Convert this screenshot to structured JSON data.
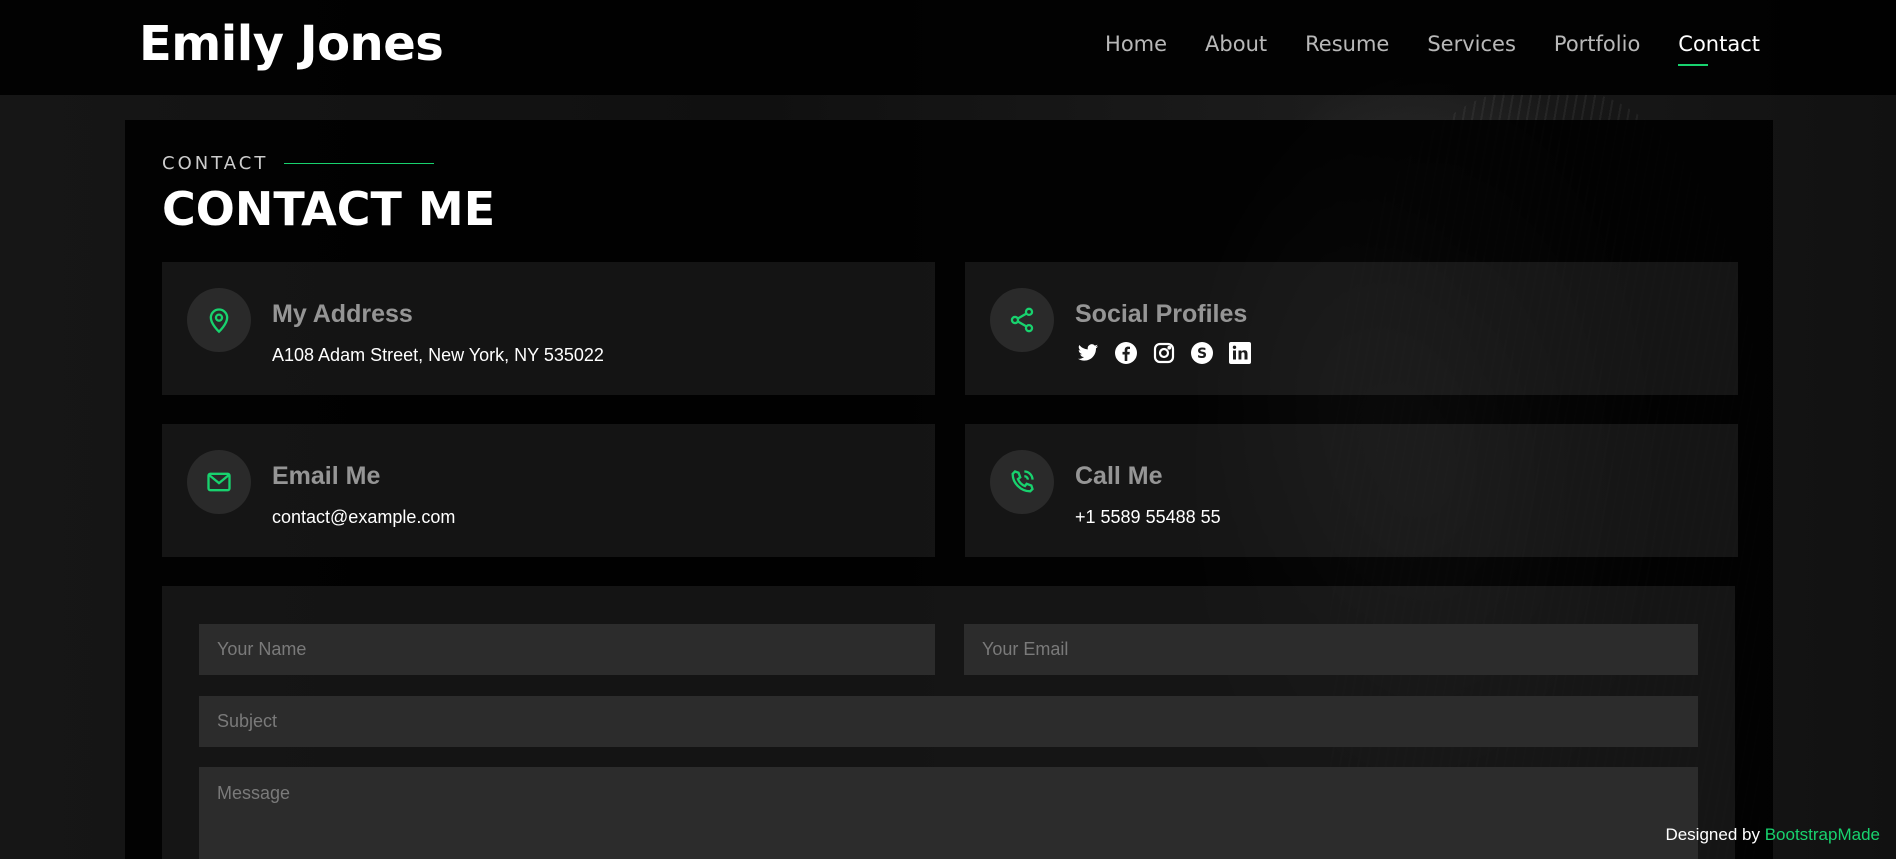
{
  "header": {
    "logo": "Emily Jones",
    "nav": [
      "Home",
      "About",
      "Resume",
      "Services",
      "Portfolio",
      "Contact"
    ],
    "active": "Contact"
  },
  "section": {
    "label": "CONTACT",
    "title": "CONTACT ME"
  },
  "cards": {
    "address": {
      "title": "My Address",
      "text": "A108 Adam Street, New York, NY 535022",
      "icon": "map-pin-icon"
    },
    "social": {
      "title": "Social Profiles",
      "icons": [
        "twitter-icon",
        "facebook-icon",
        "instagram-icon",
        "skype-icon",
        "linkedin-icon"
      ],
      "icon": "share-icon"
    },
    "email": {
      "title": "Email Me",
      "text": "contact@example.com",
      "icon": "envelope-icon"
    },
    "phone": {
      "title": "Call Me",
      "text": "+1 5589 55488 55",
      "icon": "phone-icon"
    }
  },
  "form": {
    "name_placeholder": "Your Name",
    "email_placeholder": "Your Email",
    "subject_placeholder": "Subject",
    "message_placeholder": "Message"
  },
  "credits": {
    "prefix": "Designed by",
    "link": "BootstrapMade"
  },
  "colors": {
    "accent": "#18d26e",
    "background": "#0d0d0d"
  }
}
